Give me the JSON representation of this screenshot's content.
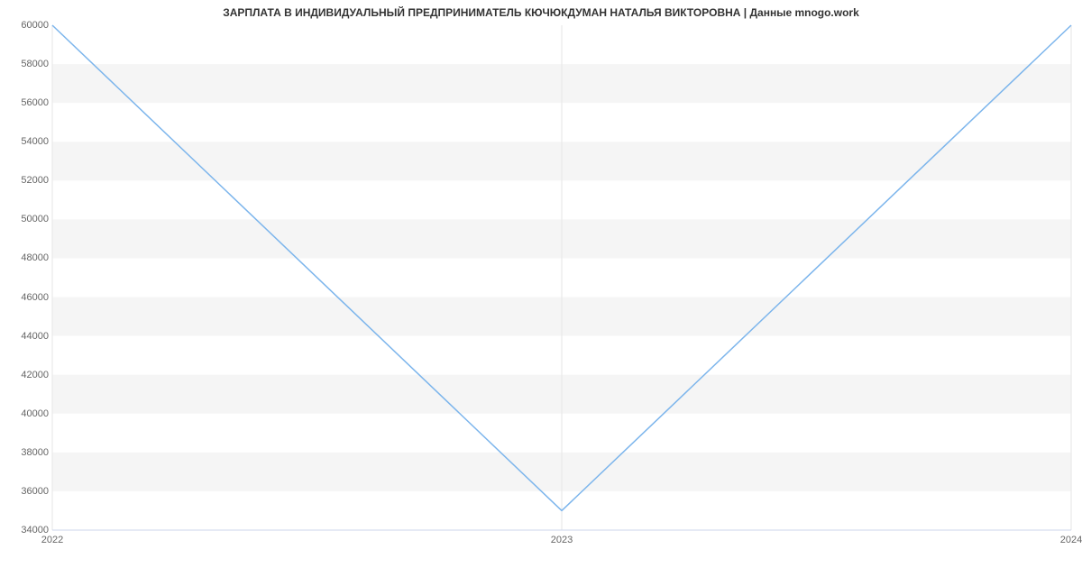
{
  "chart_data": {
    "type": "line",
    "title": "ЗАРПЛАТА В ИНДИВИДУАЛЬНЫЙ ПРЕДПРИНИМАТЕЛЬ КЮЧЮКДУМАН НАТАЛЬЯ ВИКТОРОВНА | Данные mnogo.work",
    "x": [
      "2022",
      "2023",
      "2024"
    ],
    "values": [
      60000,
      35000,
      60000
    ],
    "y_ticks": [
      34000,
      36000,
      38000,
      40000,
      42000,
      44000,
      46000,
      48000,
      50000,
      52000,
      54000,
      56000,
      58000,
      60000
    ],
    "x_ticks": [
      "2022",
      "2023",
      "2024"
    ],
    "ylim": [
      34000,
      60000
    ],
    "xlabel": "",
    "ylabel": "",
    "line_color": "#7cb5ec",
    "band_color": "#f5f5f5",
    "axis_color": "#ccd6eb",
    "grid_on": true
  }
}
